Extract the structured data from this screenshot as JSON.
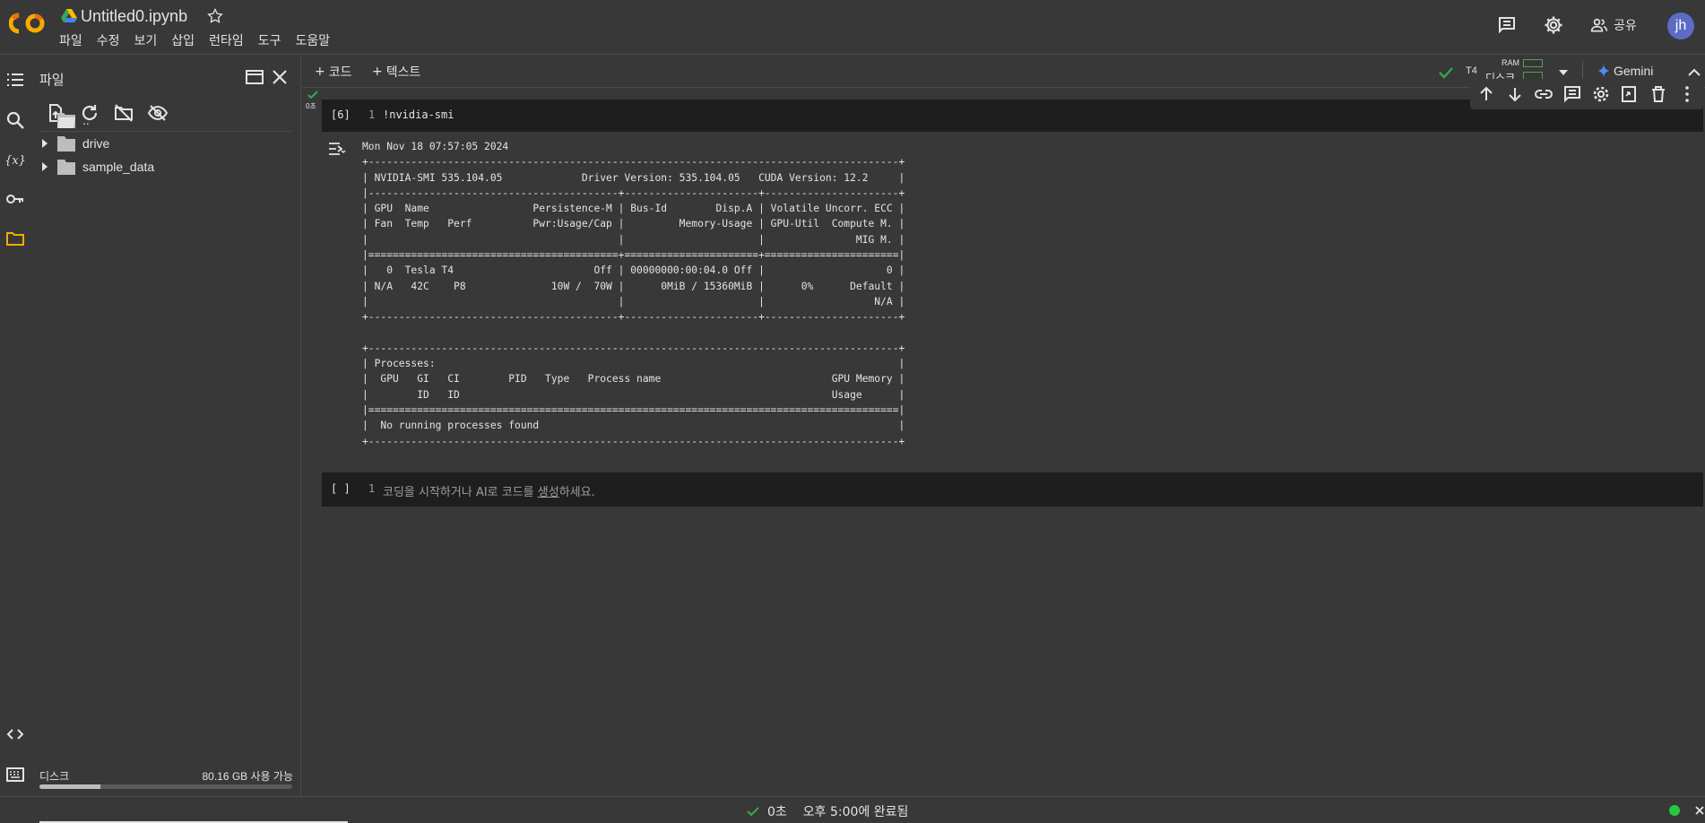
{
  "app": {
    "title": "Untitled0.ipynb",
    "menu": [
      "파일",
      "수정",
      "보기",
      "삽입",
      "런타임",
      "도구",
      "도움말"
    ],
    "share_label": "공유",
    "avatar_initials": "jh",
    "accent_color": "#f9ab00",
    "avatar_color": "#5e6bc4"
  },
  "file_panel": {
    "title": "파일",
    "tree": [
      {
        "name": "..",
        "has_caret": false
      },
      {
        "name": "drive",
        "has_caret": true
      },
      {
        "name": "sample_data",
        "has_caret": true
      }
    ],
    "disk_label": "디스크",
    "disk_free": "80.16 GB 사용 가능",
    "disk_used_fraction": 0.24
  },
  "toolbar": {
    "add_code": "코드",
    "add_text": "텍스트",
    "runtime_type": "T4",
    "ram_label": "RAM",
    "disk_label": "디스크",
    "gemini_label": "Gemini"
  },
  "cells": {
    "cell1": {
      "prompt": "[6]",
      "line_number": "1",
      "code": "!nvidia-smi",
      "exec_time": "0초"
    },
    "cell1_output": "Mon Nov 18 07:57:05 2024       \n+---------------------------------------------------------------------------------------+\n| NVIDIA-SMI 535.104.05             Driver Version: 535.104.05   CUDA Version: 12.2     |\n|-----------------------------------------+----------------------+----------------------+\n| GPU  Name                 Persistence-M | Bus-Id        Disp.A | Volatile Uncorr. ECC |\n| Fan  Temp   Perf          Pwr:Usage/Cap |         Memory-Usage | GPU-Util  Compute M. |\n|                                         |                      |               MIG M. |\n|=========================================+======================+======================|\n|   0  Tesla T4                       Off | 00000000:00:04.0 Off |                    0 |\n| N/A   42C    P8              10W /  70W |      0MiB / 15360MiB |      0%      Default |\n|                                         |                      |                  N/A |\n+-----------------------------------------+----------------------+----------------------+\n                                                                                         \n+---------------------------------------------------------------------------------------+\n| Processes:                                                                            |\n|  GPU   GI   CI        PID   Type   Process name                            GPU Memory |\n|        ID   ID                                                             Usage      |\n|=======================================================================================|\n|  No running processes found                                                           |\n+---------------------------------------------------------------------------------------+",
    "cell2": {
      "prompt": "[ ]",
      "line_number": "1",
      "placeholder_before": "코딩을 시작하거나 AI로 코드를 ",
      "placeholder_link": "생성",
      "placeholder_after": "하세요."
    }
  },
  "footer": {
    "elapsed": "0초",
    "completed": "오후 5:00에 완료됨"
  }
}
